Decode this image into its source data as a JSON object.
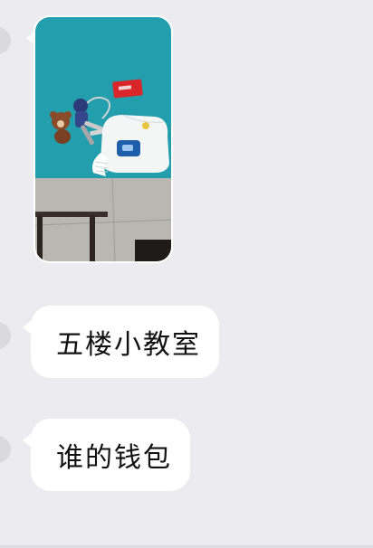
{
  "messages": [
    {
      "type": "image",
      "alt": ""
    },
    {
      "type": "text",
      "text": "五楼小教室"
    },
    {
      "type": "text",
      "text": "谁的钱包"
    }
  ]
}
